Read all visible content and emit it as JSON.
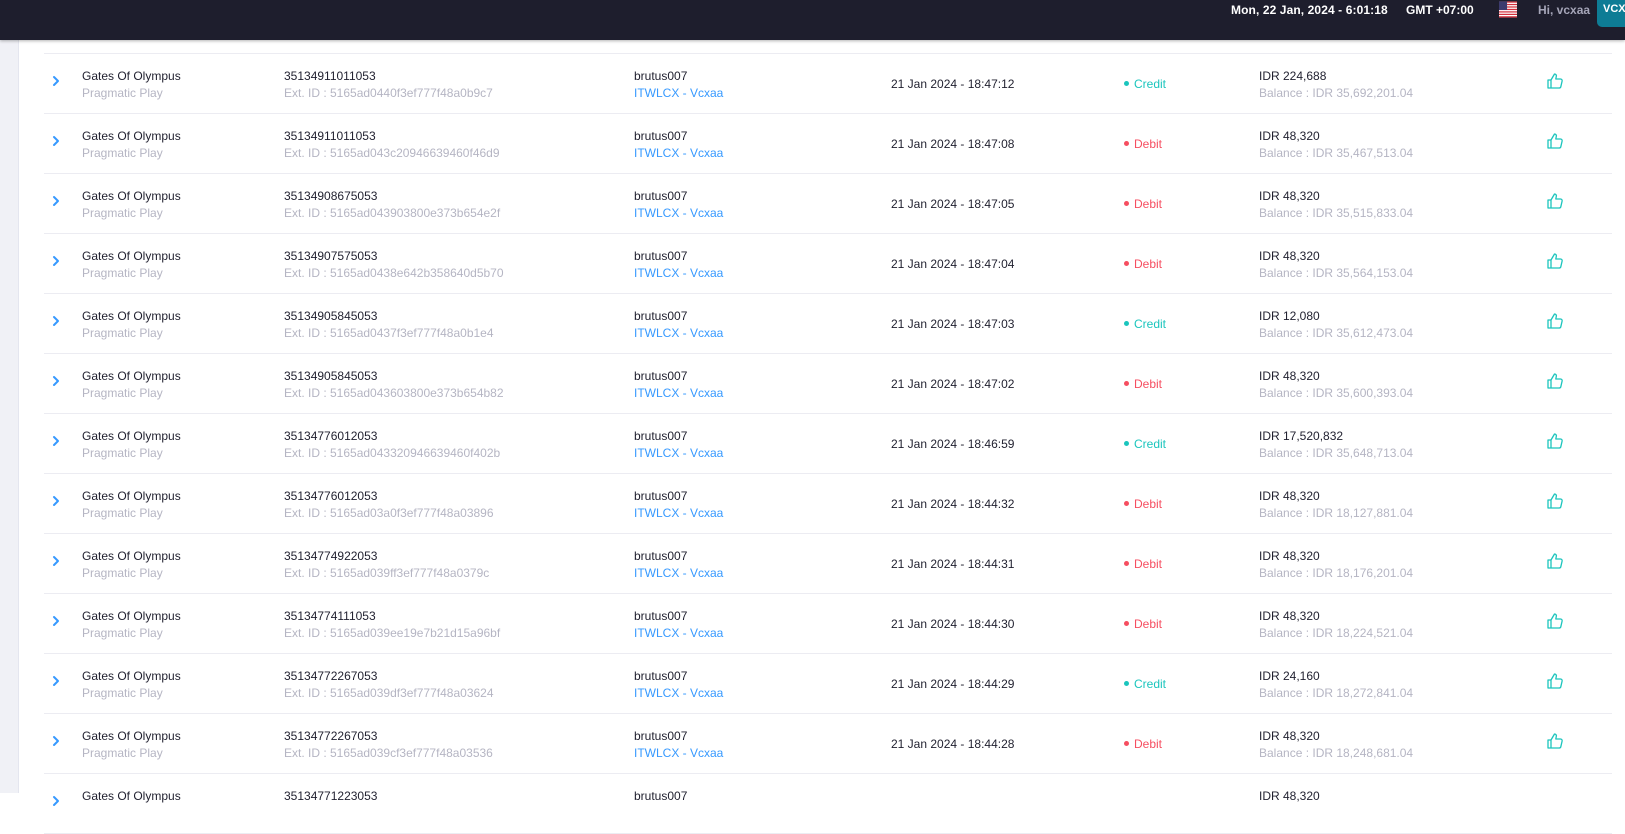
{
  "topbar": {
    "date_time": "Mon, 22 Jan, 2024 - 6:01:18",
    "timezone": "GMT +07:00",
    "greeting": "Hi, vcxaa",
    "avatar_text": "VCX"
  },
  "colors": {
    "credit": "#1bc5bd",
    "debit": "#f64e60",
    "link": "#3699ff",
    "topbar_bg": "#1e1e2d"
  },
  "transactions": [
    {
      "game": "Gates Of Olympus",
      "provider": "Pragmatic Play",
      "round_id": "35134911011053",
      "ext_id": "Ext. ID : 5165ad0440f3ef777f48a0b9c7",
      "user": "brutus007",
      "agent": "ITWLCX - Vcxaa",
      "time": "21 Jan 2024 - 18:47:12",
      "type": "Credit",
      "amount": "IDR 224,688",
      "balance": "Balance : IDR 35,692,201.04"
    },
    {
      "game": "Gates Of Olympus",
      "provider": "Pragmatic Play",
      "round_id": "35134911011053",
      "ext_id": "Ext. ID : 5165ad043c20946639460f46d9",
      "user": "brutus007",
      "agent": "ITWLCX - Vcxaa",
      "time": "21 Jan 2024 - 18:47:08",
      "type": "Debit",
      "amount": "IDR 48,320",
      "balance": "Balance : IDR 35,467,513.04"
    },
    {
      "game": "Gates Of Olympus",
      "provider": "Pragmatic Play",
      "round_id": "35134908675053",
      "ext_id": "Ext. ID : 5165ad043903800e373b654e2f",
      "user": "brutus007",
      "agent": "ITWLCX - Vcxaa",
      "time": "21 Jan 2024 - 18:47:05",
      "type": "Debit",
      "amount": "IDR 48,320",
      "balance": "Balance : IDR 35,515,833.04"
    },
    {
      "game": "Gates Of Olympus",
      "provider": "Pragmatic Play",
      "round_id": "35134907575053",
      "ext_id": "Ext. ID : 5165ad0438e642b358640d5b70",
      "user": "brutus007",
      "agent": "ITWLCX - Vcxaa",
      "time": "21 Jan 2024 - 18:47:04",
      "type": "Debit",
      "amount": "IDR 48,320",
      "balance": "Balance : IDR 35,564,153.04"
    },
    {
      "game": "Gates Of Olympus",
      "provider": "Pragmatic Play",
      "round_id": "35134905845053",
      "ext_id": "Ext. ID : 5165ad0437f3ef777f48a0b1e4",
      "user": "brutus007",
      "agent": "ITWLCX - Vcxaa",
      "time": "21 Jan 2024 - 18:47:03",
      "type": "Credit",
      "amount": "IDR 12,080",
      "balance": "Balance : IDR 35,612,473.04"
    },
    {
      "game": "Gates Of Olympus",
      "provider": "Pragmatic Play",
      "round_id": "35134905845053",
      "ext_id": "Ext. ID : 5165ad043603800e373b654b82",
      "user": "brutus007",
      "agent": "ITWLCX - Vcxaa",
      "time": "21 Jan 2024 - 18:47:02",
      "type": "Debit",
      "amount": "IDR 48,320",
      "balance": "Balance : IDR 35,600,393.04"
    },
    {
      "game": "Gates Of Olympus",
      "provider": "Pragmatic Play",
      "round_id": "35134776012053",
      "ext_id": "Ext. ID : 5165ad043320946639460f402b",
      "user": "brutus007",
      "agent": "ITWLCX - Vcxaa",
      "time": "21 Jan 2024 - 18:46:59",
      "type": "Credit",
      "amount": "IDR 17,520,832",
      "balance": "Balance : IDR 35,648,713.04"
    },
    {
      "game": "Gates Of Olympus",
      "provider": "Pragmatic Play",
      "round_id": "35134776012053",
      "ext_id": "Ext. ID : 5165ad03a0f3ef777f48a03896",
      "user": "brutus007",
      "agent": "ITWLCX - Vcxaa",
      "time": "21 Jan 2024 - 18:44:32",
      "type": "Debit",
      "amount": "IDR 48,320",
      "balance": "Balance : IDR 18,127,881.04"
    },
    {
      "game": "Gates Of Olympus",
      "provider": "Pragmatic Play",
      "round_id": "35134774922053",
      "ext_id": "Ext. ID : 5165ad039ff3ef777f48a0379c",
      "user": "brutus007",
      "agent": "ITWLCX - Vcxaa",
      "time": "21 Jan 2024 - 18:44:31",
      "type": "Debit",
      "amount": "IDR 48,320",
      "balance": "Balance : IDR 18,176,201.04"
    },
    {
      "game": "Gates Of Olympus",
      "provider": "Pragmatic Play",
      "round_id": "35134774111053",
      "ext_id": "Ext. ID : 5165ad039ee19e7b21d15a96bf",
      "user": "brutus007",
      "agent": "ITWLCX - Vcxaa",
      "time": "21 Jan 2024 - 18:44:30",
      "type": "Debit",
      "amount": "IDR 48,320",
      "balance": "Balance : IDR 18,224,521.04"
    },
    {
      "game": "Gates Of Olympus",
      "provider": "Pragmatic Play",
      "round_id": "35134772267053",
      "ext_id": "Ext. ID : 5165ad039df3ef777f48a03624",
      "user": "brutus007",
      "agent": "ITWLCX - Vcxaa",
      "time": "21 Jan 2024 - 18:44:29",
      "type": "Credit",
      "amount": "IDR 24,160",
      "balance": "Balance : IDR 18,272,841.04"
    },
    {
      "game": "Gates Of Olympus",
      "provider": "Pragmatic Play",
      "round_id": "35134772267053",
      "ext_id": "Ext. ID : 5165ad039cf3ef777f48a03536",
      "user": "brutus007",
      "agent": "ITWLCX - Vcxaa",
      "time": "21 Jan 2024 - 18:44:28",
      "type": "Debit",
      "amount": "IDR 48,320",
      "balance": "Balance : IDR 18,248,681.04"
    },
    {
      "game": "Gates Of Olympus",
      "provider": "",
      "round_id": "35134771223053",
      "ext_id": "",
      "user": "brutus007",
      "agent": "",
      "time": "",
      "type": "",
      "amount": "IDR 48,320",
      "balance": ""
    }
  ]
}
